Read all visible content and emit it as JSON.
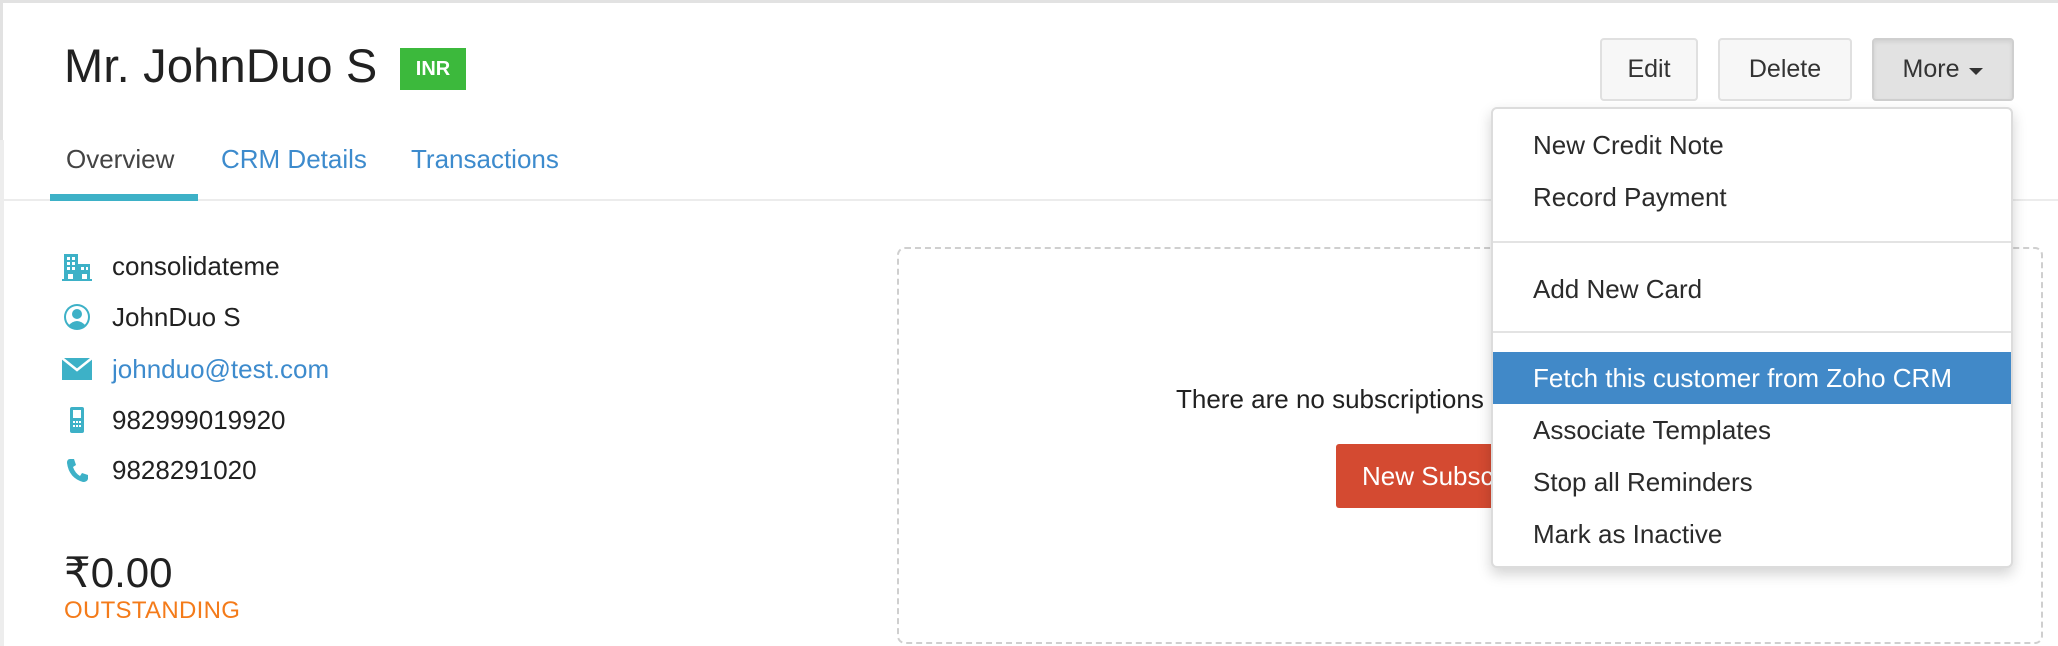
{
  "header": {
    "title": "Mr. JohnDuo S",
    "currency_badge": "INR",
    "buttons": {
      "edit": "Edit",
      "delete": "Delete",
      "more": "More"
    }
  },
  "tabs": [
    {
      "label": "Overview",
      "active": true
    },
    {
      "label": "CRM Details",
      "active": false
    },
    {
      "label": "Transactions",
      "active": false
    }
  ],
  "contact": {
    "company": {
      "icon": "building-icon",
      "value": "consolidateme"
    },
    "name": {
      "icon": "user-icon",
      "value": "JohnDuo S"
    },
    "email": {
      "icon": "mail-icon",
      "value": "johnduo@test.com"
    },
    "mobile": {
      "icon": "mobile-phone-icon",
      "value": "982999019920"
    },
    "phone": {
      "icon": "phone-icon",
      "value": "9828291020"
    }
  },
  "balance": {
    "amount": "₹0.00",
    "label": "OUTSTANDING"
  },
  "subscriptions": {
    "empty_message": "There are no subscriptions",
    "new_button": "New Subscription"
  },
  "more_menu": {
    "groups": [
      [
        "New Credit Note",
        "Record Payment"
      ],
      [
        "Add New Card"
      ],
      [
        "Fetch this customer from Zoho CRM",
        "Associate Templates",
        "Stop all Reminders",
        "Mark as Inactive"
      ]
    ],
    "highlighted": "Fetch this customer from Zoho CRM"
  },
  "colors": {
    "accent_teal": "#3db1c7",
    "link_blue": "#3d8bcd",
    "badge_green": "#3cb93c",
    "primary_red": "#d44a31",
    "outstanding_orange": "#f47b1a",
    "menu_highlight": "#4189c8"
  }
}
